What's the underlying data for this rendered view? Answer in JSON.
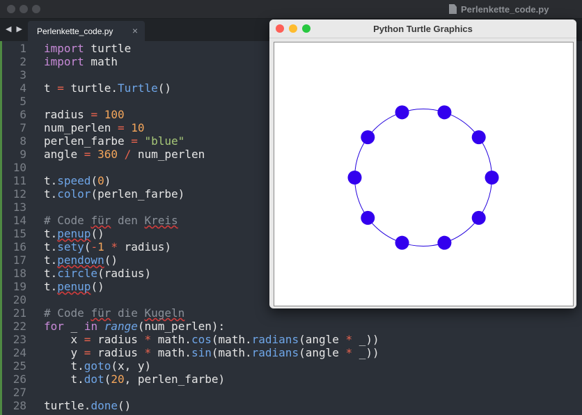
{
  "editor": {
    "window_title": "Perlenkette_code.py",
    "tab": {
      "label": "Perlenkette_code.py",
      "close": "×"
    },
    "nav_arrows": "◀ ▶"
  },
  "code_lines": [
    {
      "n": "1",
      "segs": [
        [
          "kw",
          "import"
        ],
        [
          "",
          " turtle"
        ]
      ]
    },
    {
      "n": "2",
      "segs": [
        [
          "kw",
          "import"
        ],
        [
          "",
          " math"
        ]
      ]
    },
    {
      "n": "3",
      "segs": []
    },
    {
      "n": "4",
      "segs": [
        [
          "",
          "t "
        ],
        [
          "op",
          "="
        ],
        [
          "",
          " turtle."
        ],
        [
          "fn",
          "Turtle"
        ],
        [
          "",
          "()"
        ]
      ]
    },
    {
      "n": "5",
      "segs": []
    },
    {
      "n": "6",
      "segs": [
        [
          "",
          "radius "
        ],
        [
          "op",
          "="
        ],
        [
          "",
          " "
        ],
        [
          "num",
          "100"
        ]
      ]
    },
    {
      "n": "7",
      "segs": [
        [
          "",
          "num_perlen "
        ],
        [
          "op",
          "="
        ],
        [
          "",
          " "
        ],
        [
          "num",
          "10"
        ]
      ]
    },
    {
      "n": "8",
      "segs": [
        [
          "",
          "perlen_farbe "
        ],
        [
          "op",
          "="
        ],
        [
          "",
          " "
        ],
        [
          "str",
          "\"blue\""
        ]
      ]
    },
    {
      "n": "9",
      "segs": [
        [
          "",
          "angle "
        ],
        [
          "op",
          "="
        ],
        [
          "",
          " "
        ],
        [
          "num",
          "360"
        ],
        [
          "",
          " "
        ],
        [
          "op",
          "/"
        ],
        [
          "",
          " num_perlen"
        ]
      ]
    },
    {
      "n": "10",
      "segs": []
    },
    {
      "n": "11",
      "segs": [
        [
          "",
          "t."
        ],
        [
          "fn",
          "speed"
        ],
        [
          "",
          "("
        ],
        [
          "num",
          "0"
        ],
        [
          "",
          ")"
        ]
      ]
    },
    {
      "n": "12",
      "segs": [
        [
          "",
          "t."
        ],
        [
          "fn",
          "color"
        ],
        [
          "",
          "(perlen_farbe)"
        ]
      ]
    },
    {
      "n": "13",
      "segs": []
    },
    {
      "n": "14",
      "segs": [
        [
          "cm",
          "# Code "
        ],
        [
          "cm squig",
          "für"
        ],
        [
          "cm",
          " den "
        ],
        [
          "cm squig",
          "Kreis"
        ]
      ]
    },
    {
      "n": "15",
      "segs": [
        [
          "",
          "t."
        ],
        [
          "fn squig",
          "penup"
        ],
        [
          "",
          "()"
        ]
      ]
    },
    {
      "n": "16",
      "segs": [
        [
          "",
          "t."
        ],
        [
          "fn",
          "sety"
        ],
        [
          "",
          "("
        ],
        [
          "op",
          "-"
        ],
        [
          "num",
          "1"
        ],
        [
          "",
          " "
        ],
        [
          "op",
          "*"
        ],
        [
          "",
          " radius)"
        ]
      ]
    },
    {
      "n": "17",
      "segs": [
        [
          "",
          "t."
        ],
        [
          "fn squig",
          "pendown"
        ],
        [
          "",
          "()"
        ]
      ]
    },
    {
      "n": "18",
      "segs": [
        [
          "",
          "t."
        ],
        [
          "fn",
          "circle"
        ],
        [
          "",
          "(radius)"
        ]
      ]
    },
    {
      "n": "19",
      "segs": [
        [
          "",
          "t."
        ],
        [
          "fn squig",
          "penup"
        ],
        [
          "",
          "()"
        ]
      ]
    },
    {
      "n": "20",
      "segs": []
    },
    {
      "n": "21",
      "segs": [
        [
          "cm",
          "# Code "
        ],
        [
          "cm squig",
          "für"
        ],
        [
          "cm",
          " die "
        ],
        [
          "cm squig",
          "Kugeln"
        ]
      ]
    },
    {
      "n": "22",
      "segs": [
        [
          "kw",
          "for"
        ],
        [
          "",
          " _ "
        ],
        [
          "kw",
          "in"
        ],
        [
          "",
          " "
        ],
        [
          "it",
          "range"
        ],
        [
          "",
          "(num_perlen):"
        ]
      ]
    },
    {
      "n": "23",
      "segs": [
        [
          "",
          "    x "
        ],
        [
          "op",
          "="
        ],
        [
          "",
          " radius "
        ],
        [
          "op",
          "*"
        ],
        [
          "",
          " math."
        ],
        [
          "fn",
          "cos"
        ],
        [
          "",
          "(math."
        ],
        [
          "fn",
          "radians"
        ],
        [
          "",
          "(angle "
        ],
        [
          "op",
          "*"
        ],
        [
          "",
          " _))"
        ]
      ]
    },
    {
      "n": "24",
      "segs": [
        [
          "",
          "    y "
        ],
        [
          "op",
          "="
        ],
        [
          "",
          " radius "
        ],
        [
          "op",
          "*"
        ],
        [
          "",
          " math."
        ],
        [
          "fn",
          "sin"
        ],
        [
          "",
          "(math."
        ],
        [
          "fn",
          "radians"
        ],
        [
          "",
          "(angle "
        ],
        [
          "op",
          "*"
        ],
        [
          "",
          " _))"
        ]
      ]
    },
    {
      "n": "25",
      "segs": [
        [
          "",
          "    t."
        ],
        [
          "fn",
          "goto"
        ],
        [
          "",
          "(x, y)"
        ]
      ]
    },
    {
      "n": "26",
      "segs": [
        [
          "",
          "    t."
        ],
        [
          "fn",
          "dot"
        ],
        [
          "",
          "("
        ],
        [
          "num",
          "20"
        ],
        [
          "",
          ", perlen_farbe)"
        ]
      ]
    },
    {
      "n": "27",
      "segs": []
    },
    {
      "n": "28",
      "segs": [
        [
          "",
          "turtle."
        ],
        [
          "fn",
          "done"
        ],
        [
          "",
          "()"
        ]
      ]
    }
  ],
  "turtle_window": {
    "title": "Python Turtle Graphics",
    "circle_color": "#2200dd",
    "dot_color": "#3300ee",
    "radius_units": 100,
    "num_beads": 10,
    "angle_step_deg": 36
  }
}
